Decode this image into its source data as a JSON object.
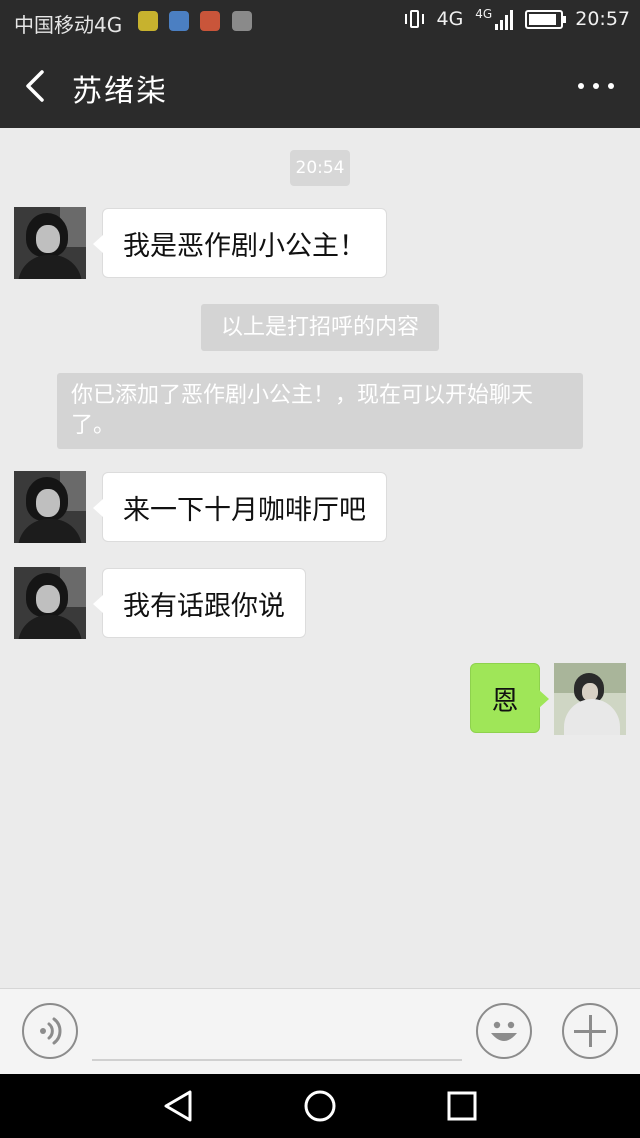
{
  "status_bar": {
    "carrier": "中国移动4G",
    "network": "4G",
    "network2": "4G",
    "time": "20:57",
    "battery_level": 0.9,
    "app_icons": [
      "sprout-app-icon",
      "blue-app-icon",
      "red-app-icon",
      "gallery-app-icon"
    ],
    "app_icon_colors": [
      "#c7b22e",
      "#4b7fc2",
      "#c9553a",
      "#8a8a8a"
    ]
  },
  "header": {
    "back_icon": "chevron-left-icon",
    "title": "苏绪柒",
    "more_icon": "more-dots-icon"
  },
  "chat": {
    "timestamp": "20:54",
    "messages": [
      {
        "from": "other",
        "text": "我是恶作剧小公主！"
      },
      {
        "from": "other",
        "text": "来一下十月咖啡厅吧"
      },
      {
        "from": "other",
        "text": "我有话跟你说"
      },
      {
        "from": "me",
        "text": "恩"
      }
    ],
    "system": {
      "greeting_notice": "以上是打招呼的内容",
      "added_notice": "你已添加了恶作剧小公主！，现在可以开始聊天了。"
    }
  },
  "input_bar": {
    "voice_icon": "voice-icon",
    "emoji_icon": "emoji-icon",
    "plus_icon": "plus-icon"
  },
  "colors": {
    "header_bg": "#2b2b2b",
    "chat_bg": "#ebebeb",
    "my_bubble": "#9fe658",
    "system_bg": "#d4d4d4"
  }
}
